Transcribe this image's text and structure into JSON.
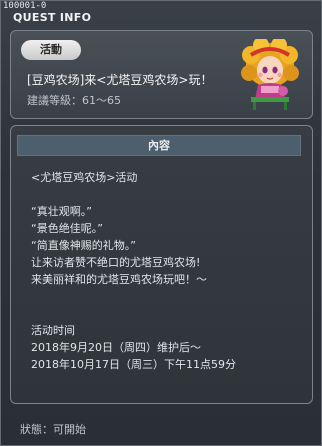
{
  "window": {
    "quest_id": "100001-0",
    "title": "QUEST INFO"
  },
  "header": {
    "tag": "活動",
    "quest_name": "[豆鸡农场]来<尤塔豆鸡农场>玩！",
    "level_label": "建議等級：61～65"
  },
  "content": {
    "header": "內容",
    "lines": [
      "<尤塔豆鸡农场>活动",
      "",
      "“真壮观啊。”",
      "“景色绝佳呢。”",
      "“简直像神赐的礼物。”",
      "让来访者赞不绝口的尤塔豆鸡农场!",
      "来美丽祥和的尤塔豆鸡农场玩吧！～",
      "",
      "",
      "活动时间",
      "2018年9月20日（周四）维护后～",
      "2018年10月17日（周三）下午11点59分"
    ]
  },
  "status": "狀態：可開始"
}
